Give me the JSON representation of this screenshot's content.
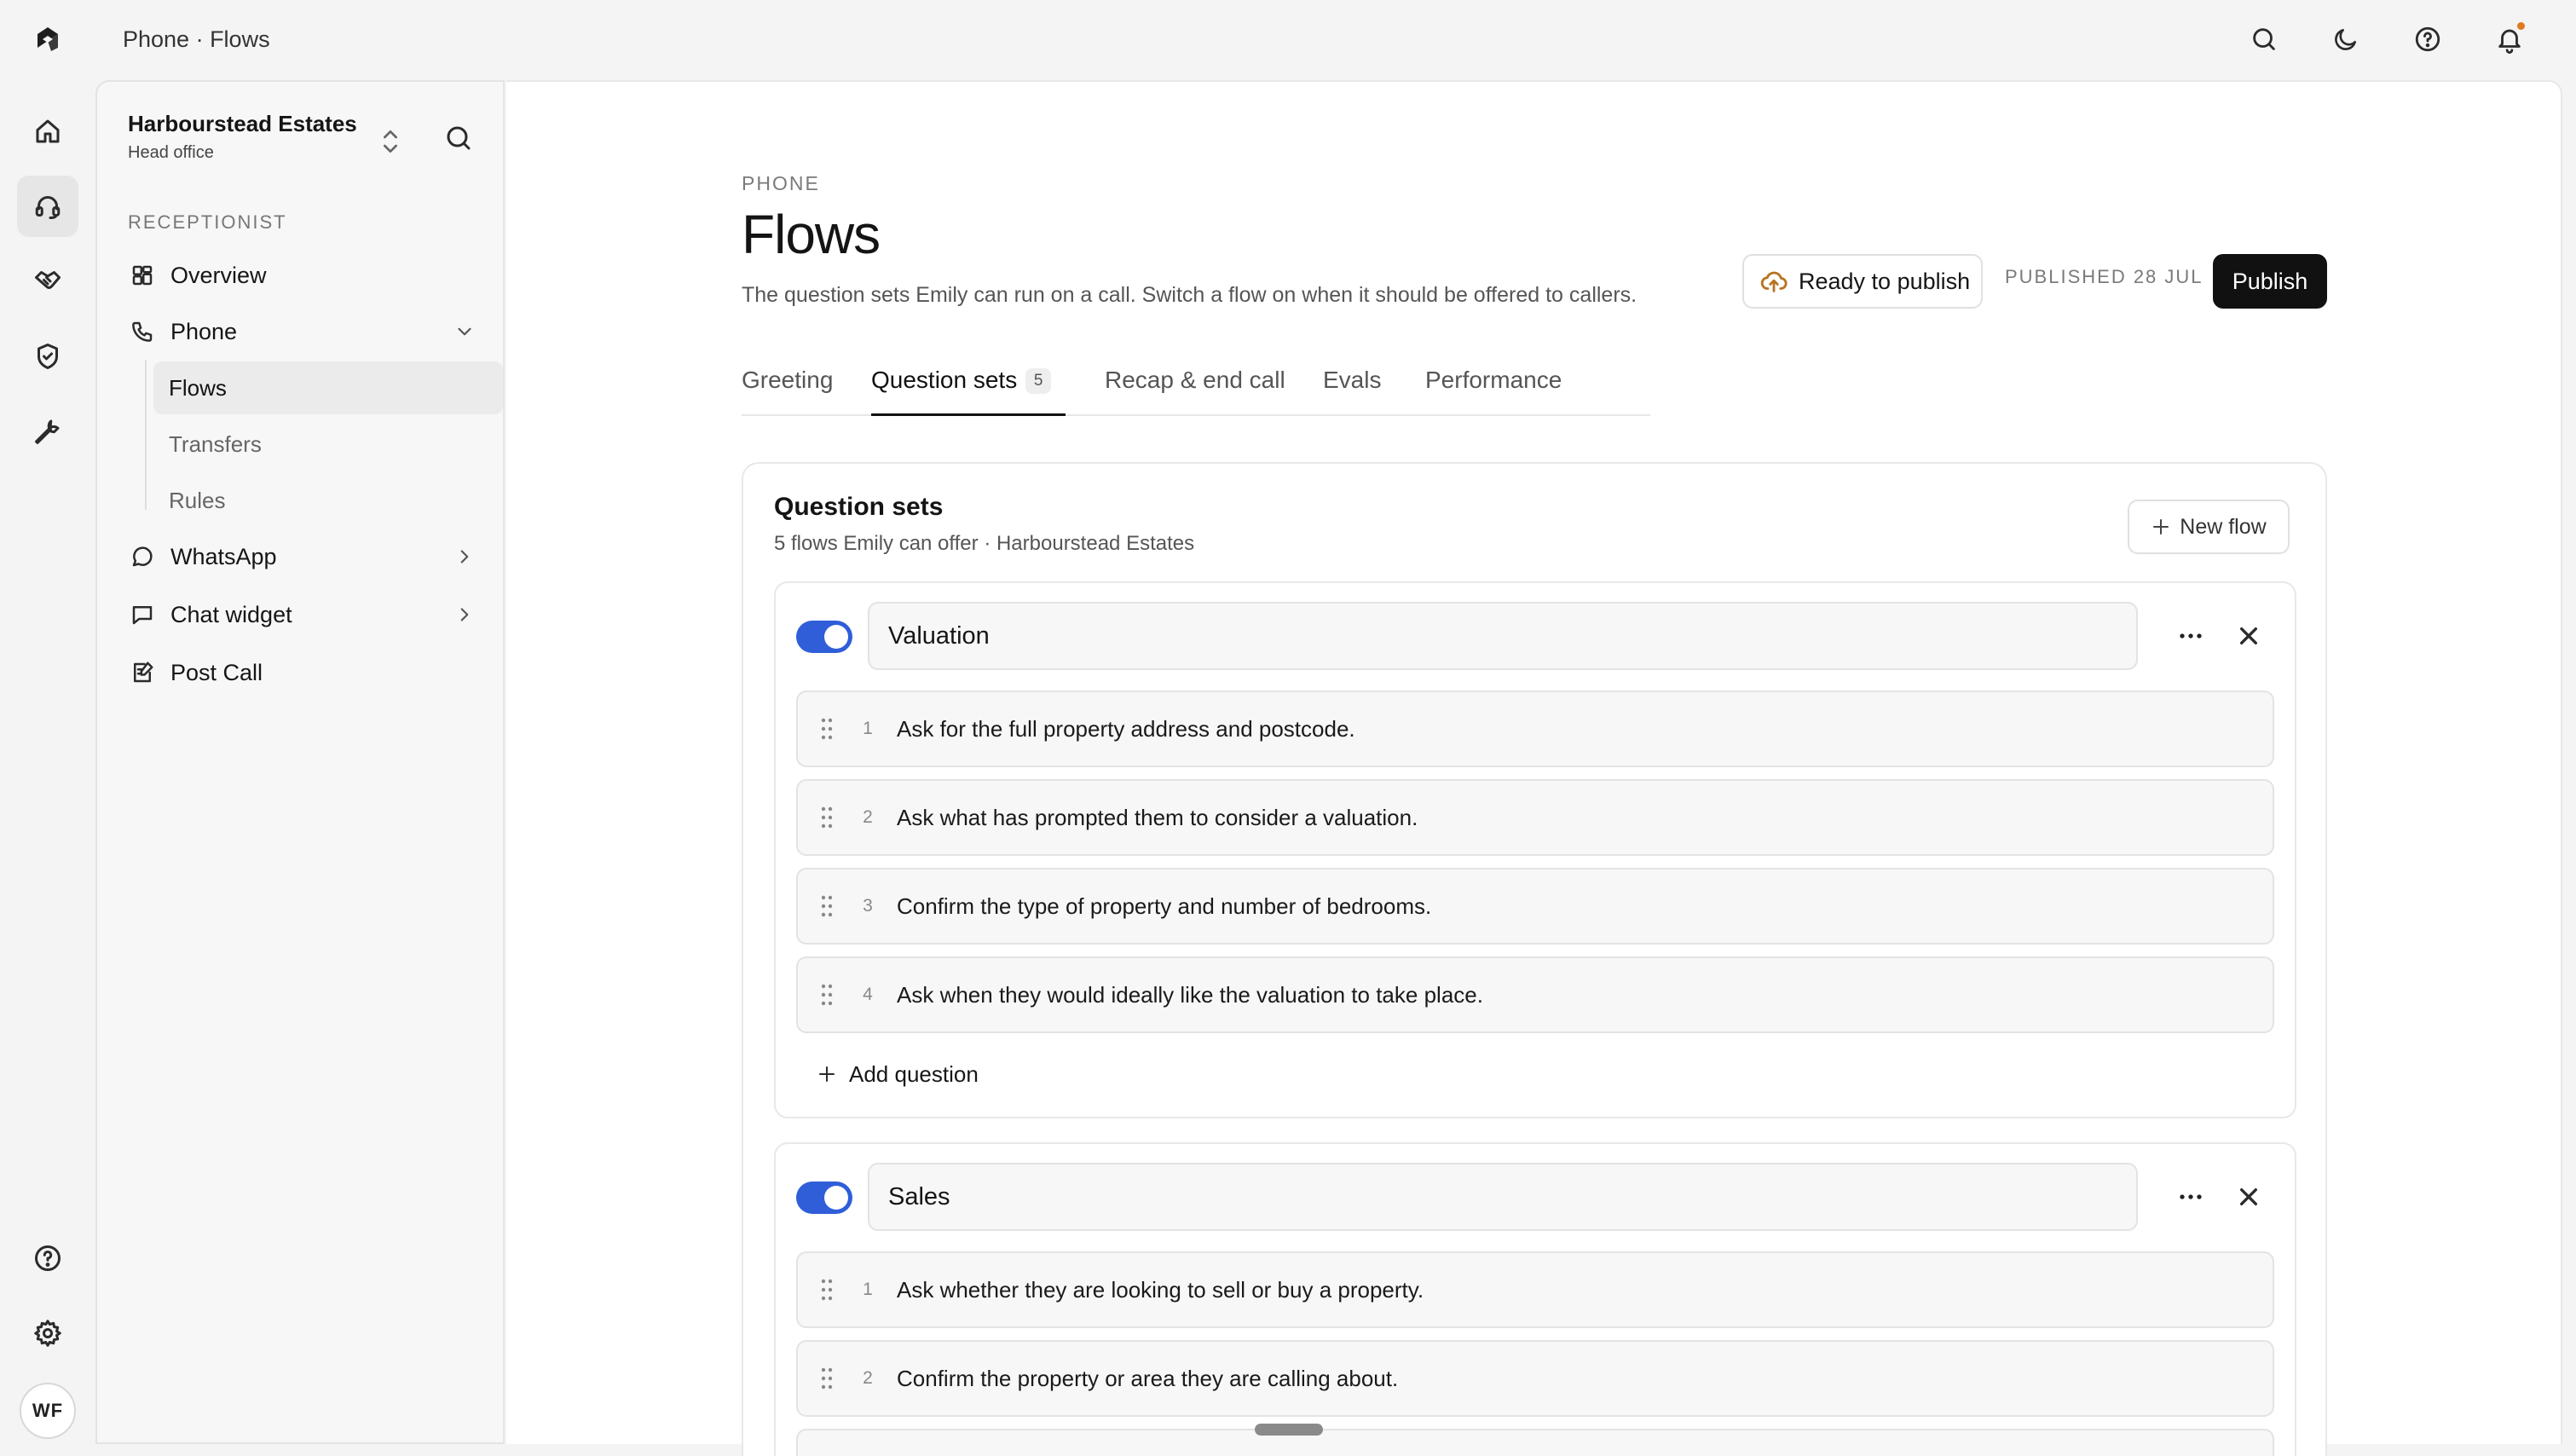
{
  "topbar": {
    "breadcrumb": "Phone · Flows",
    "icons": [
      "search-icon",
      "moon-icon",
      "help-icon",
      "bell-icon"
    ]
  },
  "rail": {
    "icons": [
      "home-icon",
      "headset-icon",
      "handshake-icon",
      "shield-check-icon",
      "wrench-icon",
      "help-icon",
      "gear-icon"
    ],
    "avatar_initials": "WF"
  },
  "sidebar": {
    "org_name": "Harbourstead Estates",
    "org_sub": "Head office",
    "section_label": "RECEPTIONIST",
    "items": [
      {
        "label": "Overview",
        "icon": "grid-icon"
      },
      {
        "label": "Phone",
        "icon": "phone-icon"
      },
      {
        "label": "WhatsApp",
        "icon": "chat-bubble-icon"
      },
      {
        "label": "Chat widget",
        "icon": "message-square-icon"
      },
      {
        "label": "Post Call",
        "icon": "clipboard-edit-icon"
      }
    ],
    "phone_sub": [
      {
        "label": "Flows"
      },
      {
        "label": "Transfers"
      },
      {
        "label": "Rules"
      }
    ]
  },
  "page": {
    "eyebrow": "PHONE",
    "title": "Flows",
    "description": "The question sets Emily can run on a call. Switch a flow on when it should be offered to callers.",
    "ready_label": "Ready to publish",
    "published_label": "PUBLISHED 28 JUL",
    "publish_label": "Publish"
  },
  "tabs": [
    {
      "label": "Greeting"
    },
    {
      "label": "Question sets",
      "count": "5"
    },
    {
      "label": "Recap & end call"
    },
    {
      "label": "Evals"
    },
    {
      "label": "Performance"
    }
  ],
  "card": {
    "title": "Question sets",
    "subtitle": "5 flows Emily can offer · Harbourstead Estates",
    "new_flow_label": "New flow",
    "add_question_label": "Add question",
    "flows": [
      {
        "name": "Valuation",
        "enabled": true,
        "questions": [
          {
            "num": "1",
            "text": "Ask for the full property address and postcode."
          },
          {
            "num": "2",
            "text": "Ask what has prompted them to consider a valuation."
          },
          {
            "num": "3",
            "text": "Confirm the type of property and number of bedrooms."
          },
          {
            "num": "4",
            "text": "Ask when they would ideally like the valuation to take place."
          }
        ]
      },
      {
        "name": "Sales",
        "enabled": true,
        "questions": [
          {
            "num": "1",
            "text": "Ask whether they are looking to sell or buy a property."
          },
          {
            "num": "2",
            "text": "Confirm the property or area they are calling about."
          }
        ]
      }
    ]
  },
  "colors": {
    "accent": "#2f5ed8",
    "publish_bg": "#111111",
    "notification": "#e07a1f"
  }
}
